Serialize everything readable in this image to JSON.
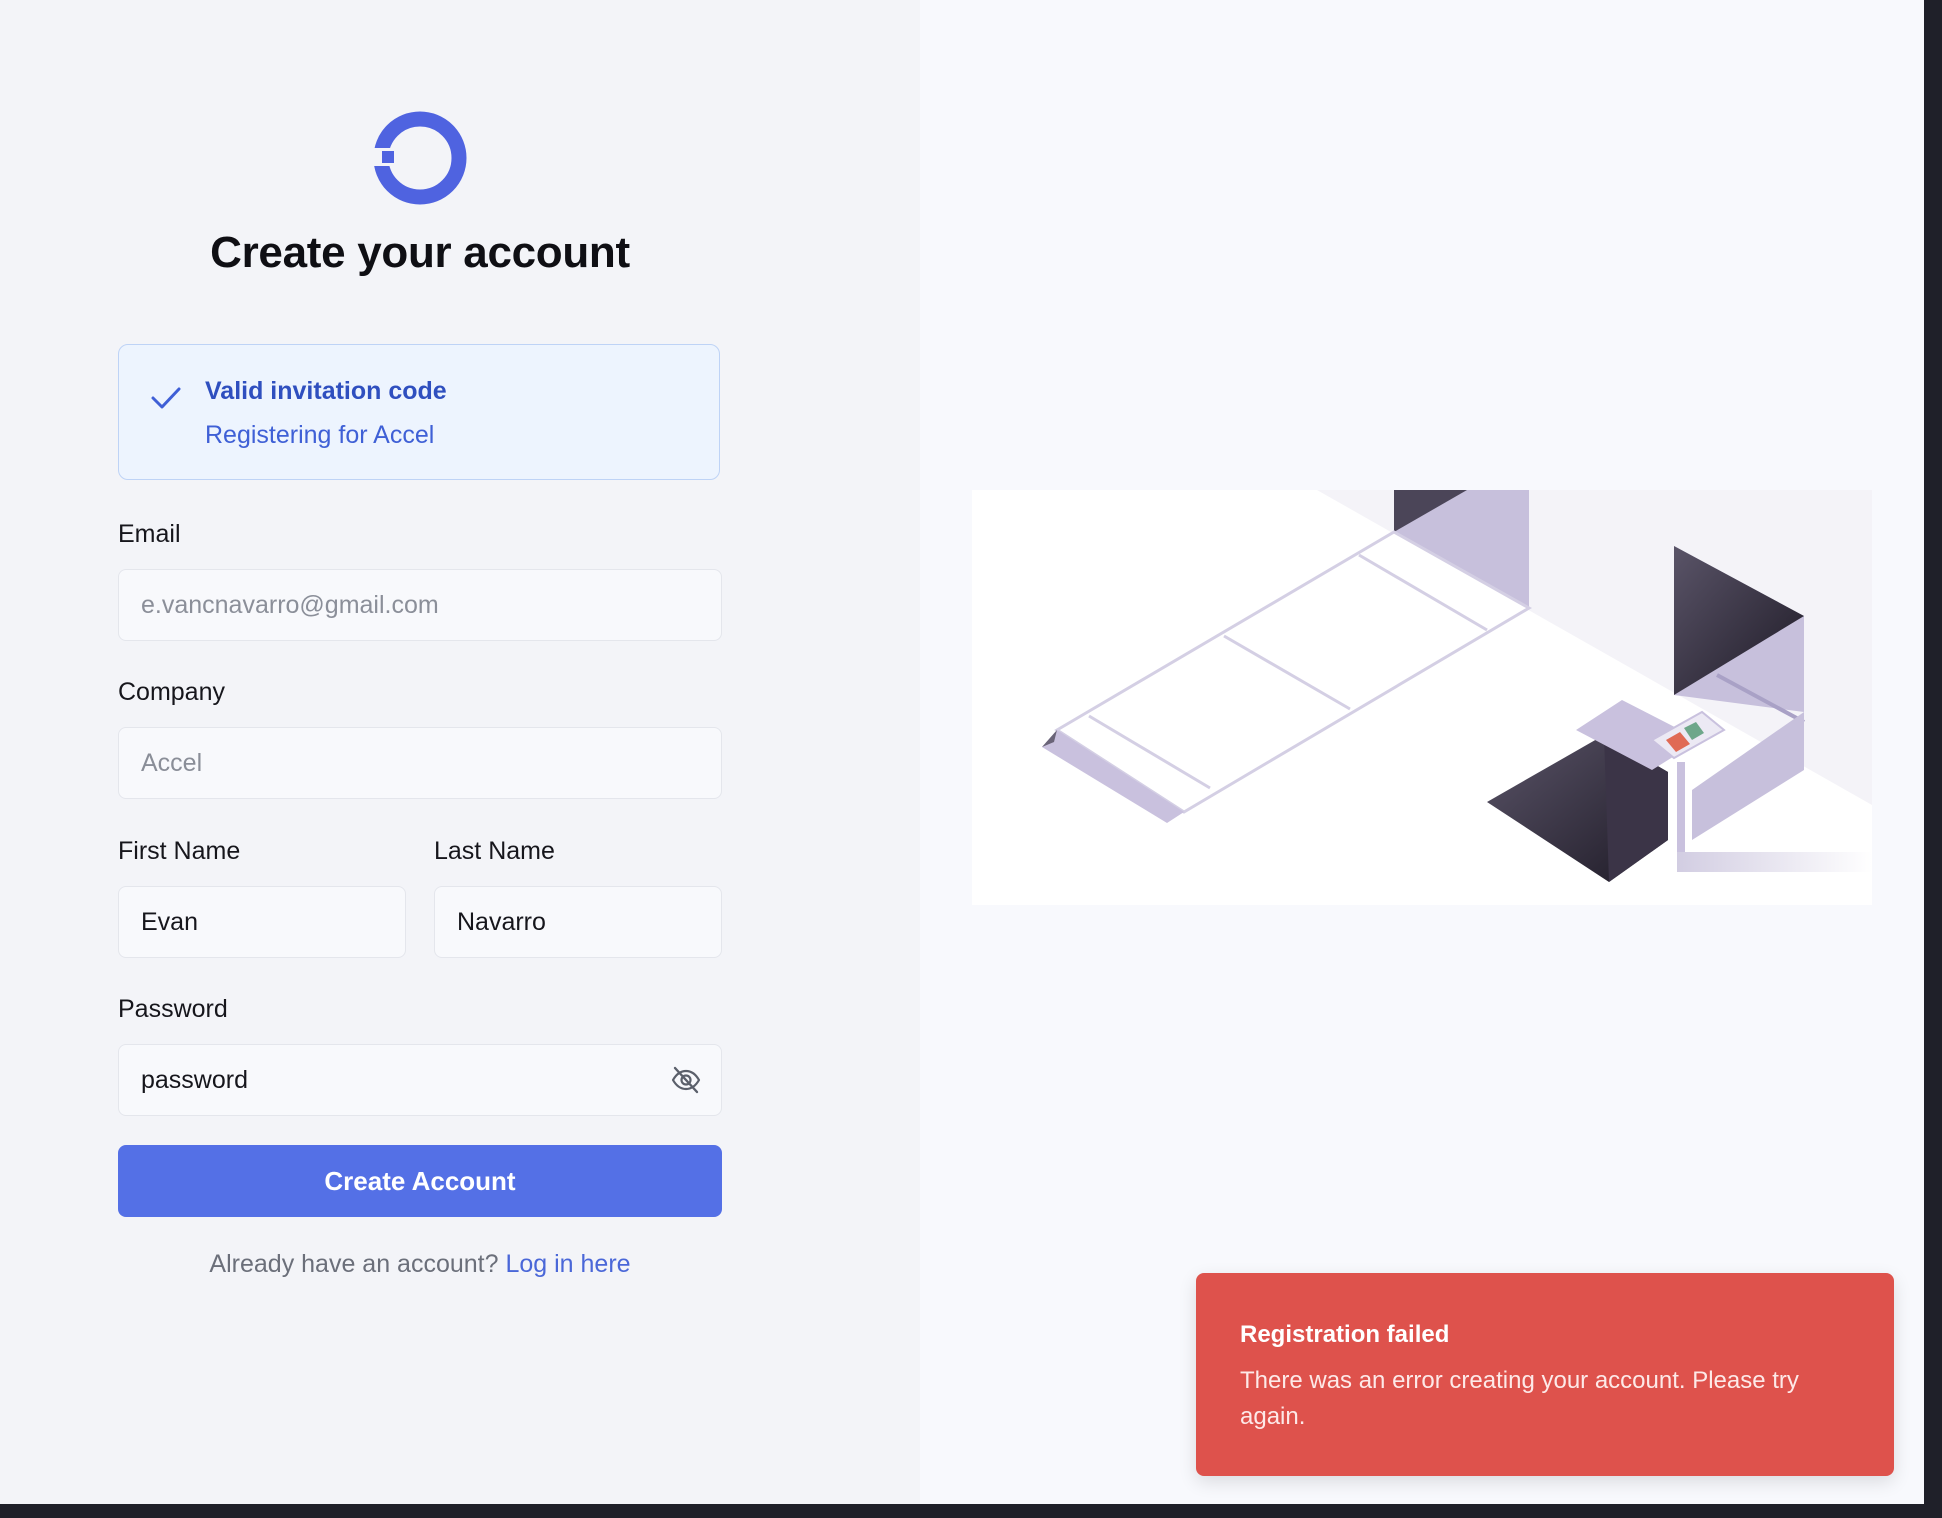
{
  "page": {
    "title": "Create your account"
  },
  "invitation": {
    "title": "Valid invitation code",
    "subtitle": "Registering for Accel"
  },
  "form": {
    "email": {
      "label": "Email",
      "placeholder": "e.vancnavarro@gmail.com",
      "value": ""
    },
    "company": {
      "label": "Company",
      "value": "Accel"
    },
    "first_name": {
      "label": "First Name",
      "value": "Evan"
    },
    "last_name": {
      "label": "Last Name",
      "value": "Navarro"
    },
    "password": {
      "label": "Password",
      "value": "password",
      "toggle_icon": "eye-off-icon"
    },
    "submit_label": "Create Account"
  },
  "login": {
    "prompt": "Already have an account?",
    "link_label": "Log in here"
  },
  "toast": {
    "title": "Registration failed",
    "message": "There was an error creating your account. Please try again."
  },
  "colors": {
    "accent": "#5470e6",
    "error": "#de524c",
    "info_bg": "#edf4fe"
  }
}
